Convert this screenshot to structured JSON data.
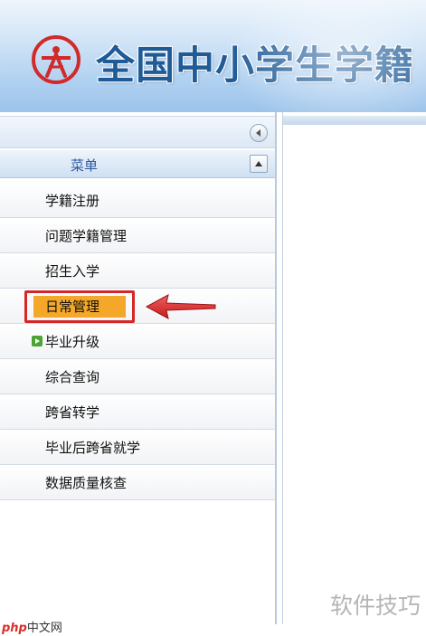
{
  "header": {
    "title": "全国中小学生学籍"
  },
  "sidebar": {
    "menu_header": "菜单",
    "items": [
      {
        "label": "学籍注册"
      },
      {
        "label": "问题学籍管理"
      },
      {
        "label": "招生入学"
      },
      {
        "label": "日常管理",
        "highlighted": true
      },
      {
        "label": "毕业升级",
        "current": true
      },
      {
        "label": "综合查询"
      },
      {
        "label": "跨省转学"
      },
      {
        "label": "毕业后跨省就学"
      },
      {
        "label": "数据质量核查"
      }
    ]
  },
  "watermarks": {
    "left_brand": "php",
    "left_text": "中文网",
    "right_text": "软件技巧"
  },
  "colors": {
    "highlight_box": "#d62728",
    "highlight_fill": "#f4a728",
    "title_blue": "#1f5b97",
    "menu_header_blue": "#2b58a0",
    "current_icon_green": "#4aa532"
  },
  "icons": {
    "logo": "school-emblem-icon",
    "collapse": "collapse-left-icon",
    "menu_toggle": "chevron-up-icon",
    "current": "play-arrow-icon"
  }
}
